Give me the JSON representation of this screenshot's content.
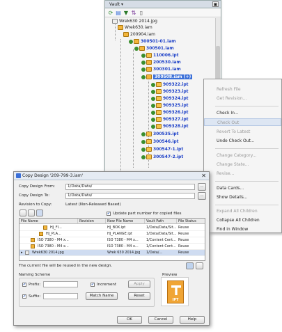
{
  "vault": {
    "title": "Vault ▾",
    "tree": [
      {
        "label": "Wrek630 2014.jpg"
      },
      {
        "label": "Wrek630.iam"
      },
      {
        "label": "200904.iam"
      },
      {
        "label": "300501-01.iam"
      },
      {
        "label": "300501.iam"
      },
      {
        "label": "110006.ipt"
      },
      {
        "label": "200530.iam"
      },
      {
        "label": "300301.iam"
      },
      {
        "label": "300508.iam (+)"
      },
      {
        "label": "909322.ipt"
      },
      {
        "label": "909323.ipt"
      },
      {
        "label": "909324.ipt"
      },
      {
        "label": "909325.ipt"
      },
      {
        "label": "909326.ipt"
      },
      {
        "label": "909327.ipt"
      },
      {
        "label": "909328.ipt"
      },
      {
        "label": "300535.ipt"
      },
      {
        "label": "300546.ipt"
      },
      {
        "label": "300547-1.ipt"
      },
      {
        "label": "300547-2.ipt"
      }
    ]
  },
  "context_menu": {
    "items": [
      {
        "label": "Refresh File"
      },
      {
        "label": "Get Revision..."
      },
      {
        "label": "Check In..."
      },
      {
        "label": "Check Out"
      },
      {
        "label": "Revert To Latest"
      },
      {
        "label": "Undo Check Out..."
      },
      {
        "label": "Change Category..."
      },
      {
        "label": "Change State..."
      },
      {
        "label": "Revise..."
      },
      {
        "label": "Data Cards..."
      },
      {
        "label": "Show Details..."
      },
      {
        "label": "Expand All Children"
      },
      {
        "label": "Collapse All Children"
      },
      {
        "label": "Find in Window"
      }
    ]
  },
  "dialog": {
    "title": "Copy Design '209-799-3.iam'",
    "copy_from_label": "Copy Design From:",
    "copy_from_value": "1/Data/Data/",
    "copy_to_label": "Copy Design To:",
    "copy_to_value": "1/Data/Data/",
    "revision_label": "Revision to Copy:",
    "revision_value": "Latest (Non-Released Based)",
    "update_part_number_label": "Update part number for copied files",
    "columns": [
      "File Name",
      "Revision",
      "New File Name",
      "Vault Path",
      "File Status"
    ],
    "rows": [
      {
        "file": "HJ_FI...",
        "rev": "",
        "new": "HJ_BOX.ipt",
        "path": "1/Data/Data/Sit...",
        "status": "Reuse"
      },
      {
        "file": "HJ_PLA...",
        "rev": "",
        "new": "HJ_PLANGE.ipt",
        "path": "1/Data/Data/Sit...",
        "status": "Reuse"
      },
      {
        "file": "ISO 7380 - M4 x...",
        "rev": "",
        "new": "ISO 7380 - M4 x...",
        "path": "1/Content Cent...",
        "status": "Reuse"
      },
      {
        "file": "ISO 7380 - M4 x...",
        "rev": "",
        "new": "ISO 7380 - M4 x...",
        "path": "1/Content Cent...",
        "status": "Reuse"
      },
      {
        "file": "Wrek630 2014.jpg",
        "rev": "",
        "new": "Wrek 630 2014.jpg",
        "path": "1/Data/...",
        "status": "Reuse"
      }
    ],
    "info_text": "The current file will be reused in the new design.",
    "naming_label": "Naming Scheme",
    "prefix_label": "Prefix:",
    "suffix_label": "Suffix:",
    "increment_label": "Increment",
    "apply_label": "Apply",
    "match_name_label": "Match Name",
    "reset_label": "Reset",
    "preview_label": "Preview",
    "preview_ext": "IPT",
    "ok_label": "OK",
    "cancel_label": "Cancel",
    "help_label": "Help",
    "browse_label": "..."
  }
}
